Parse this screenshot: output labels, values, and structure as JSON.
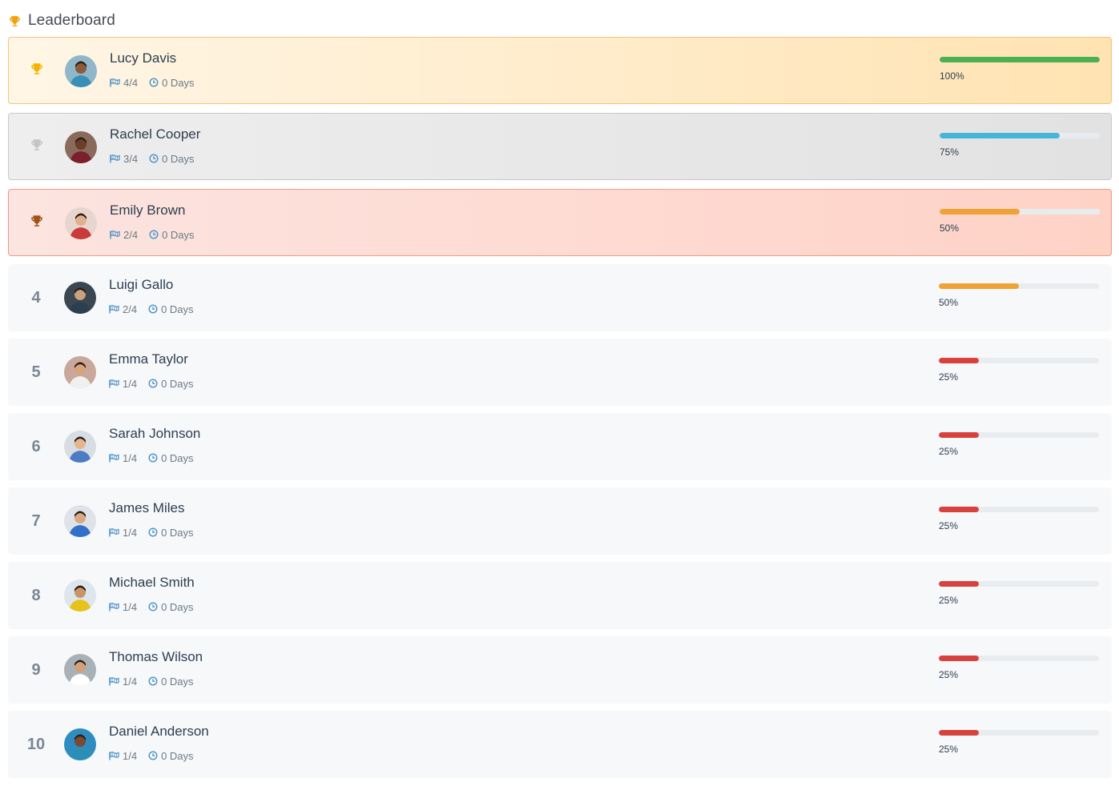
{
  "header": {
    "title": "Leaderboard",
    "icon": "trophy-icon",
    "icon_color": "#f0a30a"
  },
  "colors": {
    "gold": "#f5b301",
    "silver": "#c4c4c4",
    "bronze": "#a0521a",
    "green": "#4caf50",
    "blue": "#45b5da",
    "orange": "#f0a236",
    "red": "#d9413f",
    "flag": "#4a90c8",
    "clock": "#4a90c8"
  },
  "entries": [
    {
      "rank": "1",
      "medal": "gold",
      "name": "Lucy Davis",
      "tasks": "4/4",
      "days": "0 Days",
      "progress": "100%",
      "fraction": 1.0,
      "bar_color": "#4caf50"
    },
    {
      "rank": "2",
      "medal": "silver",
      "name": "Rachel Cooper",
      "tasks": "3/4",
      "days": "0 Days",
      "progress": "75%",
      "fraction": 0.75,
      "bar_color": "#45b5da"
    },
    {
      "rank": "3",
      "medal": "bronze",
      "name": "Emily Brown",
      "tasks": "2/4",
      "days": "0 Days",
      "progress": "50%",
      "fraction": 0.5,
      "bar_color": "#f0a236"
    },
    {
      "rank": "4",
      "medal": "",
      "name": "Luigi Gallo",
      "tasks": "2/4",
      "days": "0 Days",
      "progress": "50%",
      "fraction": 0.5,
      "bar_color": "#f0a236"
    },
    {
      "rank": "5",
      "medal": "",
      "name": "Emma Taylor",
      "tasks": "1/4",
      "days": "0 Days",
      "progress": "25%",
      "fraction": 0.25,
      "bar_color": "#d9413f"
    },
    {
      "rank": "6",
      "medal": "",
      "name": "Sarah Johnson",
      "tasks": "1/4",
      "days": "0 Days",
      "progress": "25%",
      "fraction": 0.25,
      "bar_color": "#d9413f"
    },
    {
      "rank": "7",
      "medal": "",
      "name": "James Miles",
      "tasks": "1/4",
      "days": "0 Days",
      "progress": "25%",
      "fraction": 0.25,
      "bar_color": "#d9413f"
    },
    {
      "rank": "8",
      "medal": "",
      "name": "Michael Smith",
      "tasks": "1/4",
      "days": "0 Days",
      "progress": "25%",
      "fraction": 0.25,
      "bar_color": "#d9413f"
    },
    {
      "rank": "9",
      "medal": "",
      "name": "Thomas Wilson",
      "tasks": "1/4",
      "days": "0 Days",
      "progress": "25%",
      "fraction": 0.25,
      "bar_color": "#d9413f"
    },
    {
      "rank": "10",
      "medal": "",
      "name": "Daniel Anderson",
      "tasks": "1/4",
      "days": "0 Days",
      "progress": "25%",
      "fraction": 0.25,
      "bar_color": "#d9413f"
    }
  ]
}
